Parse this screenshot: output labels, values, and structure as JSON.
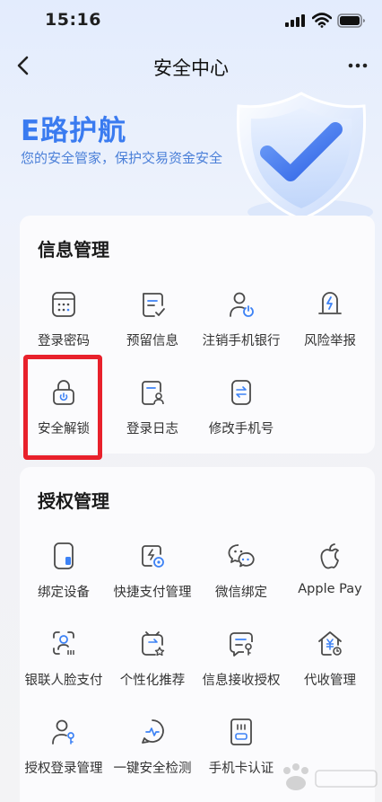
{
  "status": {
    "time": "15:16"
  },
  "nav": {
    "title": "安全中心",
    "back_icon": "chevron-left-icon",
    "more_icon": "more-dots-icon"
  },
  "banner": {
    "title": "E路护航",
    "subtitle": "您的安全管家，保护交易资金安全",
    "shield_icon": "shield-check-icon"
  },
  "info_section": {
    "title": "信息管理",
    "items": [
      {
        "label": "登录密码",
        "icon": "keypad-icon"
      },
      {
        "label": "预留信息",
        "icon": "note-check-icon"
      },
      {
        "label": "注销手机银行",
        "icon": "user-power-icon"
      },
      {
        "label": "风险举报",
        "icon": "lightning-report-icon"
      },
      {
        "label": "安全解锁",
        "icon": "lock-icon"
      },
      {
        "label": "登录日志",
        "icon": "log-user-icon"
      },
      {
        "label": "修改手机号",
        "icon": "phone-swap-icon"
      }
    ]
  },
  "auth_section": {
    "title": "授权管理",
    "items": [
      {
        "label": "绑定设备",
        "icon": "device-bind-icon"
      },
      {
        "label": "快捷支付管理",
        "icon": "quick-pay-icon"
      },
      {
        "label": "微信绑定",
        "icon": "wechat-icon"
      },
      {
        "label": "Apple Pay",
        "icon": "apple-icon"
      },
      {
        "label": "银联人脸支付",
        "icon": "face-pay-icon"
      },
      {
        "label": "个性化推荐",
        "icon": "recommend-icon"
      },
      {
        "label": "信息接收授权",
        "icon": "message-auth-icon"
      },
      {
        "label": "代收管理",
        "icon": "collection-house-icon"
      },
      {
        "label": "授权登录管理",
        "icon": "auth-login-icon"
      },
      {
        "label": "一键安全检测",
        "icon": "security-scan-icon"
      },
      {
        "label": "手机卡认证",
        "icon": "sim-card-icon"
      }
    ]
  },
  "colors": {
    "accent": "#3a7bf0",
    "highlight": "#e8212b",
    "icon_stroke": "#4a4a4a",
    "icon_accent": "#3d82f5"
  }
}
